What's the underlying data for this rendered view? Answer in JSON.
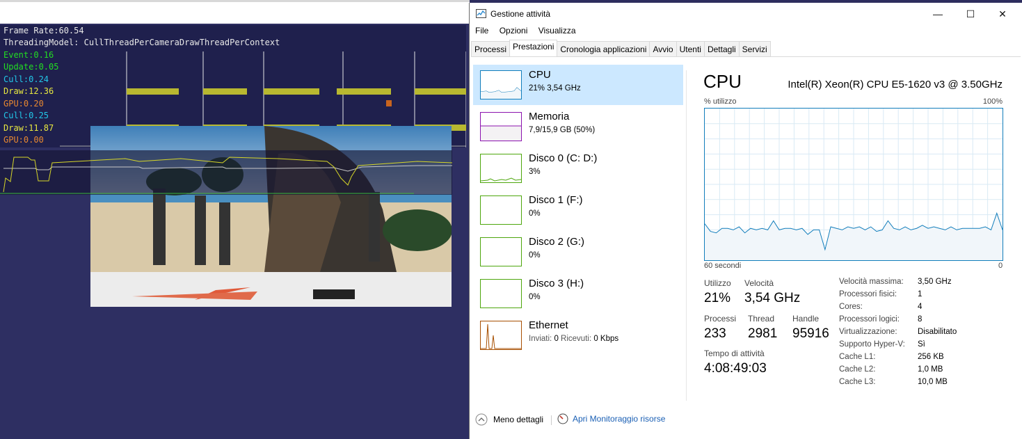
{
  "osg": {
    "frame_rate": "Frame Rate:60.54",
    "threading_model": "ThreadingModel: CullThreadPerCameraDrawThreadPerContext",
    "stats": [
      {
        "text": "Event:0.16",
        "color": "#22dd22"
      },
      {
        "text": "Update:0.05",
        "color": "#22dd22"
      },
      {
        "text": "Cull:0.24",
        "color": "#22c8e8"
      },
      {
        "text": "Draw:12.36",
        "color": "#e8e840"
      },
      {
        "text": "GPU:0.20",
        "color": "#e88830"
      },
      {
        "text": "Cull:0.25",
        "color": "#22c8e8"
      },
      {
        "text": "Draw:11.87",
        "color": "#e8e840"
      },
      {
        "text": "GPU:0.00",
        "color": "#e88830"
      }
    ]
  },
  "taskmanager": {
    "title": "Gestione attività",
    "icon": "task-manager-icon",
    "window_buttons": {
      "minimize": "—",
      "maximize": "☐",
      "close": "✕"
    },
    "menu": [
      "File",
      "Opzioni",
      "Visualizza"
    ],
    "tabs": [
      "Processi",
      "Prestazioni",
      "Cronologia applicazioni",
      "Avvio",
      "Utenti",
      "Dettagli",
      "Servizi"
    ],
    "active_tab": "Prestazioni",
    "resources": [
      {
        "name": "CPU",
        "sub": "21% 3,54 GHz",
        "color": "#117dbb",
        "selected": true
      },
      {
        "name": "Memoria",
        "sub": "7,9/15,9 GB (50%)",
        "color": "#8b12ae",
        "selected": false
      },
      {
        "name": "Disco 0 (C: D:)",
        "sub": "3%",
        "color": "#4da60c",
        "selected": false
      },
      {
        "name": "Disco 1 (F:)",
        "sub": "0%",
        "color": "#4da60c",
        "selected": false
      },
      {
        "name": "Disco 2 (G:)",
        "sub": "0%",
        "color": "#4da60c",
        "selected": false
      },
      {
        "name": "Disco 3 (H:)",
        "sub": "0%",
        "color": "#4da60c",
        "selected": false
      },
      {
        "name": "Ethernet",
        "sub_prefix": "Inviati: ",
        "sent": "0",
        "sub_mid": " Ricevuti: ",
        "received": "0 Kbps",
        "color": "#a74f01",
        "selected": false
      }
    ],
    "cpu": {
      "title": "CPU",
      "model": "Intel(R) Xeon(R) CPU E5-1620 v3 @ 3.50GHz",
      "graph_ylabel": "% utilizzo",
      "graph_ymax": "100%",
      "graph_xleft": "60 secondi",
      "graph_xright": "0",
      "utilization_history": [
        24,
        19,
        18,
        21,
        21,
        20,
        22,
        18,
        21,
        20,
        21,
        20,
        26,
        20,
        21,
        21,
        20,
        21,
        17,
        20,
        20,
        7,
        22,
        21,
        20,
        22,
        21,
        22,
        20,
        22,
        19,
        20,
        26,
        21,
        20,
        22,
        20,
        21,
        23,
        21,
        22,
        21,
        20,
        22,
        20,
        21,
        21,
        21,
        21,
        22,
        20,
        31,
        20
      ],
      "labels": {
        "utilizzo": "Utilizzo",
        "velocita": "Velocità",
        "processi": "Processi",
        "thread": "Thread",
        "handle": "Handle",
        "tempo": "Tempo di attività"
      },
      "values": {
        "utilizzo": "21%",
        "velocita": "3,54 GHz",
        "processi": "233",
        "thread": "2981",
        "handle": "95916",
        "tempo": "4:08:49:03"
      },
      "details": [
        {
          "label": "Velocità massima:",
          "value": "3,50 GHz"
        },
        {
          "label": "Processori fisici:",
          "value": "1"
        },
        {
          "label": "Cores:",
          "value": "4"
        },
        {
          "label": "Processori logici:",
          "value": "8"
        },
        {
          "label": "Virtualizzazione:",
          "value": "Disabilitato"
        },
        {
          "label": "Supporto Hyper-V:",
          "value": "Sì"
        },
        {
          "label": "Cache L1:",
          "value": "256 KB"
        },
        {
          "label": "Cache L2:",
          "value": "1,0 MB"
        },
        {
          "label": "Cache L3:",
          "value": "10,0 MB"
        }
      ]
    },
    "footer": {
      "fewer_details": "Meno dettagli",
      "resource_monitor": "Apri Monitoraggio risorse"
    }
  }
}
